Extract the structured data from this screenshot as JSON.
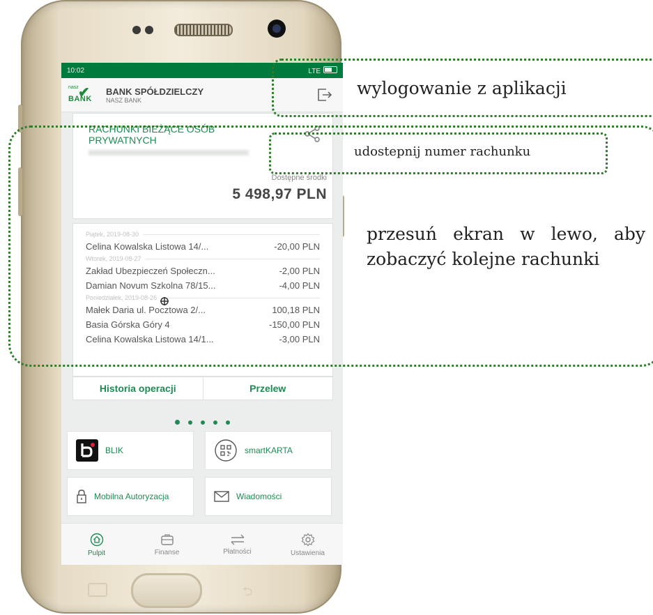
{
  "status_bar": {
    "time": "10:02",
    "network": "LTE"
  },
  "app_header": {
    "logo_top": "nasz",
    "logo_word": "BANK",
    "bank_name": "BANK SPÓŁDZIELCZY",
    "bank_sub": "NASZ BANK"
  },
  "account": {
    "title": "RACHUNKI BIEŻĄCE OSÓB PRYWATNYCH",
    "available_label": "Dostępne środki",
    "available_amount": "5 498,97 PLN"
  },
  "transactions": [
    {
      "date": "Piątek, 2019-08-30",
      "items": [
        {
          "name": "Celina Kowalska Listowa 14/...",
          "amount": "-20,00 PLN"
        }
      ]
    },
    {
      "date": "Wtorek, 2019-08-27",
      "items": [
        {
          "name": "Zakład Ubezpieczeń Społeczn...",
          "amount": "-2,00 PLN"
        },
        {
          "name": "Damian Novum Szkolna 78/15...",
          "amount": "-4,00 PLN"
        }
      ]
    },
    {
      "date": "Poniedziałek, 2019-08-26",
      "items": [
        {
          "name": "Małek Daria ul. Pocztowa 2/...",
          "amount": "100,18 PLN"
        },
        {
          "name": "Basia Górska Góry 4",
          "amount": "-150,00 PLN"
        },
        {
          "name": "Celina Kowalska Listowa 14/1...",
          "amount": "-3,00 PLN"
        }
      ]
    }
  ],
  "actions": {
    "history": "Historia operacji",
    "transfer": "Przelew"
  },
  "tiles": {
    "blik": "BLIK",
    "smartkarta": "smartKARTA",
    "mobile_auth": "Mobilna Autoryzacja",
    "messages": "Wiadomości"
  },
  "tabs": {
    "dashboard": "Pulpit",
    "finance": "Finanse",
    "payments": "Płatności",
    "settings": "Ustawienia"
  },
  "annotations": {
    "logout": "wylogowanie z aplikacji",
    "share": "udostepnij numer rachunku",
    "swipe_line1_words": [
      "przesuń",
      "ekran",
      "w",
      "lewo,",
      "aby"
    ],
    "swipe_line2": "zobaczyć kolejne rachunki"
  },
  "colors": {
    "brand_green": "#1f8a53",
    "status_green": "#007a3d",
    "annotation_dotted": "#2f7d2b"
  }
}
